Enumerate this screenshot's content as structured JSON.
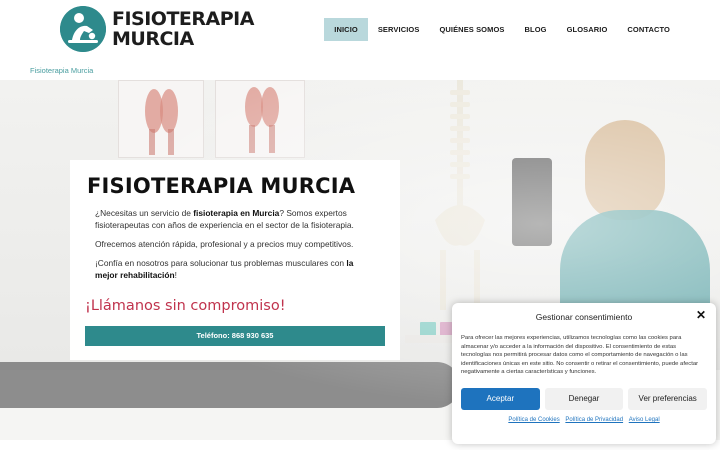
{
  "header": {
    "logo_line1": "FISIOTERAPIA",
    "logo_line2": "MURCIA",
    "nav": [
      {
        "label": "INICIO",
        "active": true
      },
      {
        "label": "SERVICIOS",
        "active": false
      },
      {
        "label": "QUIÉNES SOMOS",
        "active": false
      },
      {
        "label": "BLOG",
        "active": false
      },
      {
        "label": "GLOSARIO",
        "active": false
      },
      {
        "label": "CONTACTO",
        "active": false
      }
    ]
  },
  "breadcrumb": "Fisioterapia Murcia",
  "hero": {
    "title": "FISIOTERAPIA MURCIA",
    "p1_a": "¿Necesitas un servicio de ",
    "p1_bold": "fisioterapia en Murcia",
    "p1_b": "? Somos expertos fisioterapeutas con años de experiencia en el sector de la fisioterapia.",
    "p2": "Ofrecemos atención rápida, profesional y a precios muy competitivos.",
    "p3_a": "¡Confía en nosotros para solucionar tus problemas musculares con ",
    "p3_bold": "la mejor rehabilitación",
    "p3_b": "!",
    "cta": "¡Llámanos sin compromiso!",
    "phone_button": "Teléfono: 868 930 635"
  },
  "consent": {
    "title": "Gestionar consentimiento",
    "body": "Para ofrecer las mejores experiencias, utilizamos tecnologías como las cookies para almacenar y/o acceder a la información del dispositivo. El consentimiento de estas tecnologías nos permitirá procesar datos como el comportamiento de navegación o las identificaciones únicas en este sitio. No consentir o retirar el consentimiento, puede afectar negativamente a ciertas características y funciones.",
    "accept": "Aceptar",
    "deny": "Denegar",
    "preferences": "Ver preferencias",
    "links": [
      "Política de Cookies",
      "Política de Privacidad",
      "Aviso Legal"
    ]
  },
  "colors": {
    "brand": "#2e8a8c",
    "cta": "#c0334d",
    "accept": "#1e73be",
    "nav_active": "#b9d8dc"
  }
}
